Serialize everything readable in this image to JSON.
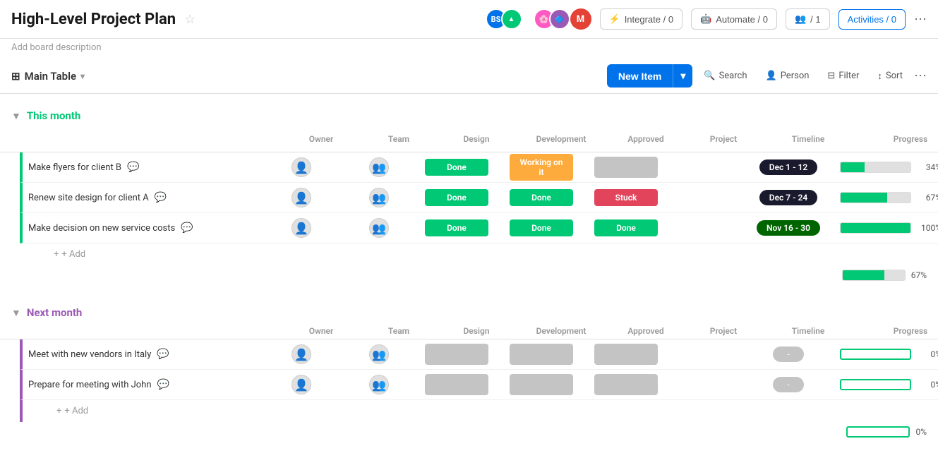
{
  "header": {
    "title": "High-Level Project Plan",
    "description": "Add board description",
    "integrate_label": "Integrate / 0",
    "automate_label": "Automate / 0",
    "members_label": "1",
    "activities_label": "Activities / 0"
  },
  "toolbar": {
    "main_table": "Main Table",
    "new_item": "New Item",
    "search": "Search",
    "person": "Person",
    "filter": "Filter",
    "sort": "Sort"
  },
  "groups": [
    {
      "id": "this_month",
      "title": "This month",
      "color": "green",
      "columns": [
        "Owner",
        "Team",
        "Design",
        "Development",
        "Approved",
        "Project",
        "Timeline",
        "Progress"
      ],
      "rows": [
        {
          "name": "Make flyers for client B",
          "design": "Done",
          "development": "Working on it",
          "approved": "",
          "timeline": "Dec 1 - 12",
          "progress": 34
        },
        {
          "name": "Renew site design for client A",
          "design": "Done",
          "development": "Done",
          "approved": "Stuck",
          "timeline": "Dec 7 - 24",
          "progress": 67
        },
        {
          "name": "Make decision on new service costs",
          "design": "Done",
          "development": "Done",
          "approved": "Done",
          "timeline": "Nov 16 - 30",
          "progress": 100
        }
      ],
      "summary_progress": 67,
      "add_label": "+ Add"
    },
    {
      "id": "next_month",
      "title": "Next month",
      "color": "purple",
      "columns": [
        "Owner",
        "Team",
        "Design",
        "Development",
        "Approved",
        "Project",
        "Timeline",
        "Progress"
      ],
      "rows": [
        {
          "name": "Meet with new vendors in Italy",
          "design": "",
          "development": "",
          "approved": "",
          "timeline": "-",
          "progress": 0
        },
        {
          "name": "Prepare for meeting with John",
          "design": "",
          "development": "",
          "approved": "",
          "timeline": "-",
          "progress": 0
        }
      ],
      "summary_progress": 0,
      "add_label": "+ Add"
    }
  ]
}
